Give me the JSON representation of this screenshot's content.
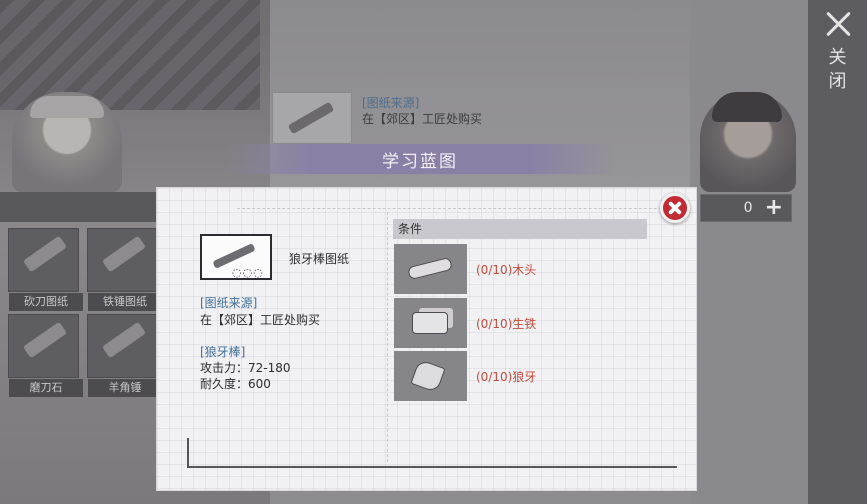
{
  "sidebar": {
    "close_label": "关闭"
  },
  "background": {
    "slots": [
      {
        "label": "砍刀图纸"
      },
      {
        "label": "铁锤图纸"
      },
      {
        "label": "磨刀石"
      },
      {
        "label": "羊角锤"
      }
    ],
    "top_card": {
      "source_label": "[图纸来源]",
      "source_text": "在【郊区】工匠处购买"
    },
    "coins": {
      "value": "0",
      "plus": "+"
    }
  },
  "modal": {
    "title": "学习蓝图",
    "blueprint_name": "狼牙棒图纸",
    "blueprint_icon_marks": "◌◌◌",
    "source_label": "[图纸来源]",
    "source_text": "在【郊区】工匠处购买",
    "item_label": "[狼牙棒]",
    "attack": "攻击力：72-180",
    "durability": "耐久度：600",
    "conditions_header": "条件",
    "conditions": [
      {
        "text": "(0/10)木头",
        "icon": "wood-icon"
      },
      {
        "text": "(0/10)生铁",
        "icon": "iron-icon"
      },
      {
        "text": "(0/10)狼牙",
        "icon": "fang-icon"
      }
    ]
  },
  "colors": {
    "accent_red": "#c22a34",
    "link_blue": "#3f6e96",
    "requirement_red": "#c24d3f",
    "title_bar": "#8a80a6"
  }
}
